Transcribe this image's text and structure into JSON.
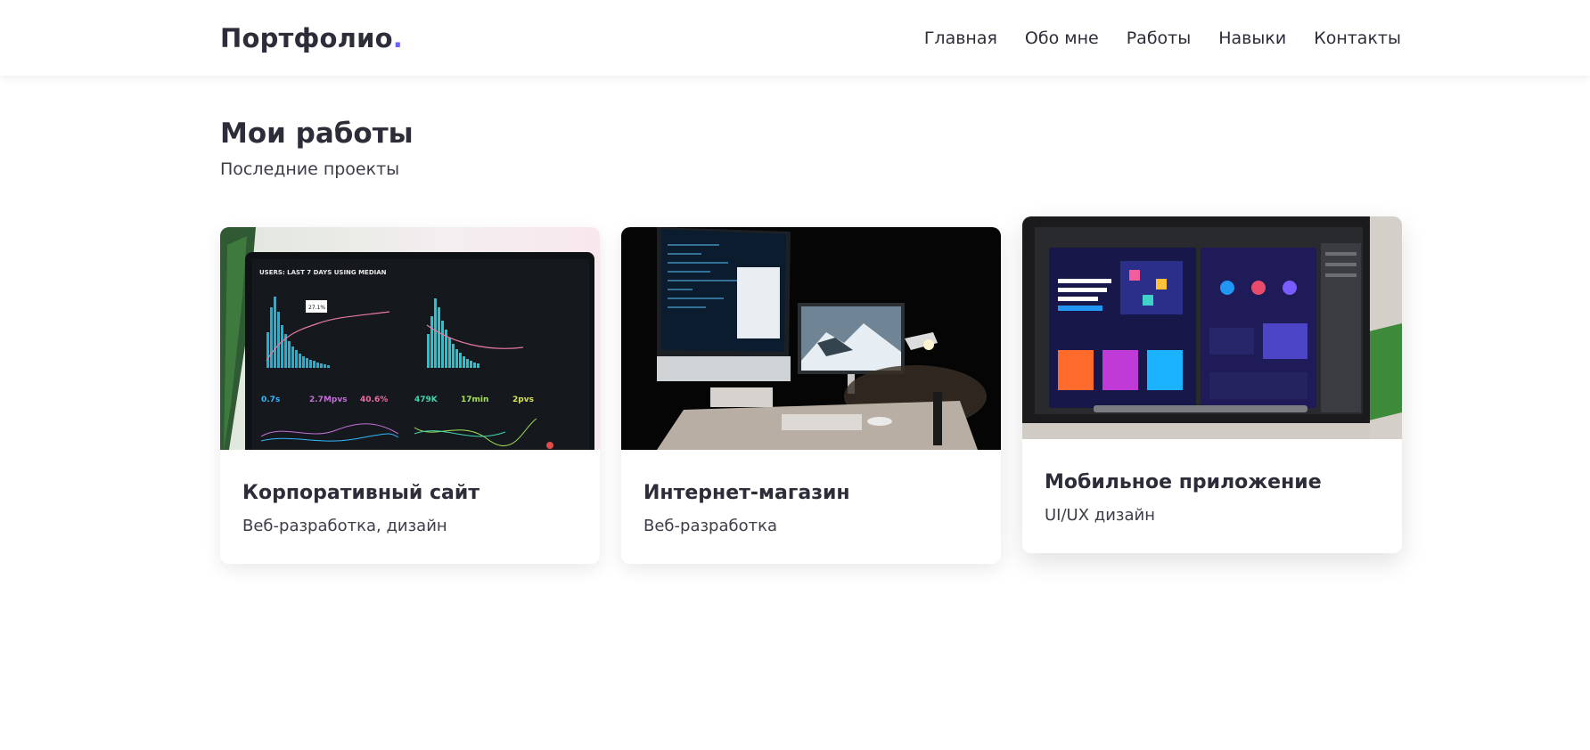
{
  "header": {
    "logo_text": "Портфолио",
    "logo_dot": ".",
    "nav": [
      "Главная",
      "Обо мне",
      "Работы",
      "Навыки",
      "Контакты"
    ]
  },
  "colors": {
    "accent": "#6c63ff",
    "text": "#2d2d3a"
  },
  "section": {
    "title": "Мои работы",
    "subtitle": "Последние проекты"
  },
  "projects": [
    {
      "title": "Корпоративный сайт",
      "tags": "Веб-разработка, дизайн",
      "image": "analytics-dashboard-photo",
      "image_texts": {
        "heading": "USERS: LAST 7 DAYS USING MEDIAN",
        "tooltip": "27.1%",
        "stat1": "0.7s",
        "stat2": "2.7Mpvs",
        "stat3": "40.6%",
        "stat4": "479K",
        "stat5": "17min",
        "stat6": "2pvs"
      }
    },
    {
      "title": "Интернет-магазин",
      "tags": "Веб-разработка",
      "image": "dark-desk-monitors-photo"
    },
    {
      "title": "Мобильное приложение",
      "tags": "UI/UX дизайн",
      "image": "design-editor-monitor-photo"
    }
  ]
}
